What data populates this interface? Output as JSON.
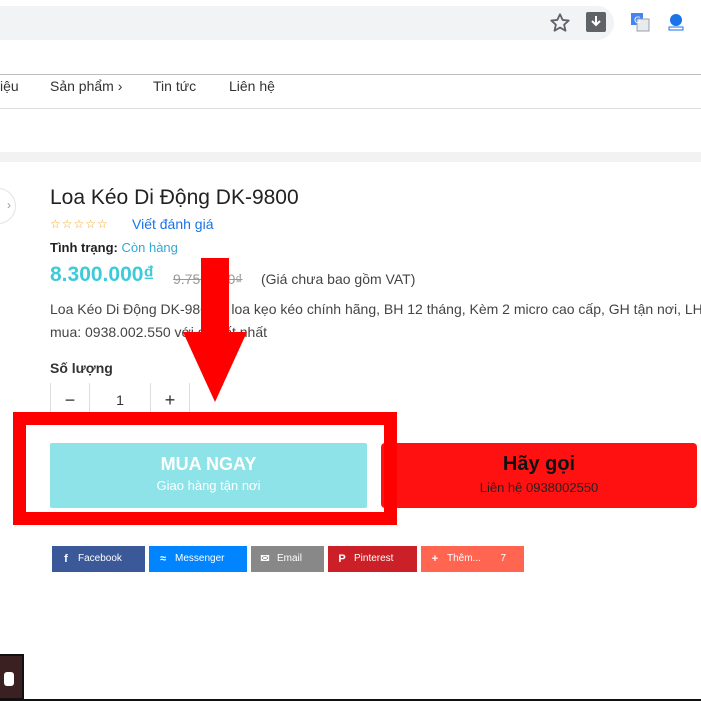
{
  "browser": {
    "icons": [
      "star-icon",
      "download-icon",
      "translate-icon",
      "extension-icon"
    ]
  },
  "nav": {
    "items": [
      {
        "label": "iệu"
      },
      {
        "label": "Sản phẩm"
      },
      {
        "label": "Tin tức"
      },
      {
        "label": "Liên hệ"
      }
    ],
    "chevron": "›"
  },
  "product": {
    "title": "Loa Kéo Di Động DK-9800",
    "rating_stars": "☆☆☆☆☆",
    "review_link": "Viết đánh giá",
    "status_label": "Tình trạng:",
    "status_value": "Còn hàng",
    "price": "8.300.000₫",
    "old_price": "9.750.000₫",
    "vat_note": "(Giá chưa bao gồm VAT)",
    "description": "Loa Kéo Di Động DK-9800 – loa kẹo kéo chính hãng, BH 12 tháng, Kèm 2 micro cao cấp, GH tận nơi, LH mua: 0938.002.550 với giá tốt nhất"
  },
  "quantity": {
    "label": "Số lượng",
    "minus": "−",
    "value": "1",
    "plus": "+"
  },
  "buy_button": {
    "label": "MUA NGAY",
    "sub": "Giao hàng tận nơi",
    "color": "#8de3e8"
  },
  "call_button": {
    "label": "Hãy gọi",
    "sub": "Liên hệ 0938002550",
    "color": "#ff1111"
  },
  "share": {
    "buttons": [
      {
        "label": "Facebook",
        "icon": "f",
        "color": "#3b5998"
      },
      {
        "label": "Messenger",
        "icon": "≈",
        "color": "#0084ff"
      },
      {
        "label": "Email",
        "icon": "✉",
        "color": "#888888"
      },
      {
        "label": "Pinterest",
        "icon": "P",
        "color": "#cb2027"
      },
      {
        "label": "Thêm...",
        "icon": "+",
        "color": "#ff6550",
        "count": "7"
      }
    ]
  },
  "annotation": {
    "color": "#ff0000"
  }
}
